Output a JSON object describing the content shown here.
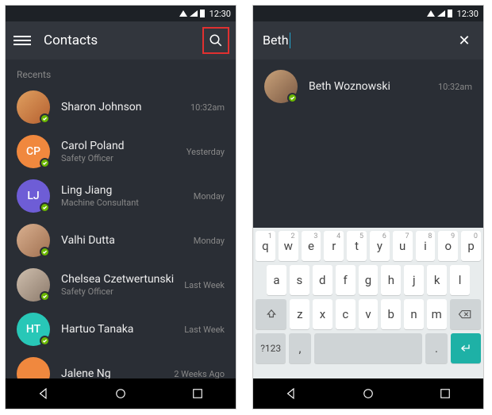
{
  "status": {
    "time": "12:30"
  },
  "left": {
    "title": "Contacts",
    "section": "Recents",
    "rows": [
      {
        "name": "Sharon Johnson",
        "sub": "",
        "time": "10:32am",
        "avatar_color_class": "img1",
        "initials": ""
      },
      {
        "name": "Carol Poland",
        "sub": "Safety Officer",
        "time": "Yesterday",
        "avatar_color_class": "img2",
        "initials": "CP"
      },
      {
        "name": "Ling Jiang",
        "sub": "Machine Consultant",
        "time": "Monday",
        "avatar_color_class": "img3",
        "initials": "LJ"
      },
      {
        "name": "Valhi Dutta",
        "sub": "",
        "time": "Monday",
        "avatar_color_class": "img4",
        "initials": ""
      },
      {
        "name": "Chelsea Czetwertunski",
        "sub": "Safety Officer",
        "time": "Last Week",
        "avatar_color_class": "img5",
        "initials": ""
      },
      {
        "name": "Hartuo Tanaka",
        "sub": "",
        "time": "Last Week",
        "avatar_color_class": "img6",
        "initials": "HT"
      },
      {
        "name": "Jalene Ng",
        "sub": "",
        "time": "2 Weeks Ago",
        "avatar_color_class": "img7",
        "initials": ""
      }
    ]
  },
  "right": {
    "search_value": "Beth",
    "result": {
      "name": "Beth Woznowski",
      "time": "10:32am",
      "avatar_color_class": "imgR"
    },
    "keyboard": {
      "row1": [
        {
          "k": "q",
          "a": "1"
        },
        {
          "k": "w",
          "a": "2"
        },
        {
          "k": "e",
          "a": "3"
        },
        {
          "k": "r",
          "a": "4"
        },
        {
          "k": "t",
          "a": "5"
        },
        {
          "k": "y",
          "a": "6"
        },
        {
          "k": "u",
          "a": "7"
        },
        {
          "k": "i",
          "a": "8"
        },
        {
          "k": "o",
          "a": "9"
        },
        {
          "k": "p",
          "a": "0"
        }
      ],
      "row2": [
        "a",
        "s",
        "d",
        "f",
        "g",
        "h",
        "j",
        "k",
        "l"
      ],
      "row3": [
        "z",
        "x",
        "c",
        "v",
        "b",
        "n",
        "m"
      ],
      "sym": "?123",
      "comma": ",",
      "dot": "."
    }
  }
}
